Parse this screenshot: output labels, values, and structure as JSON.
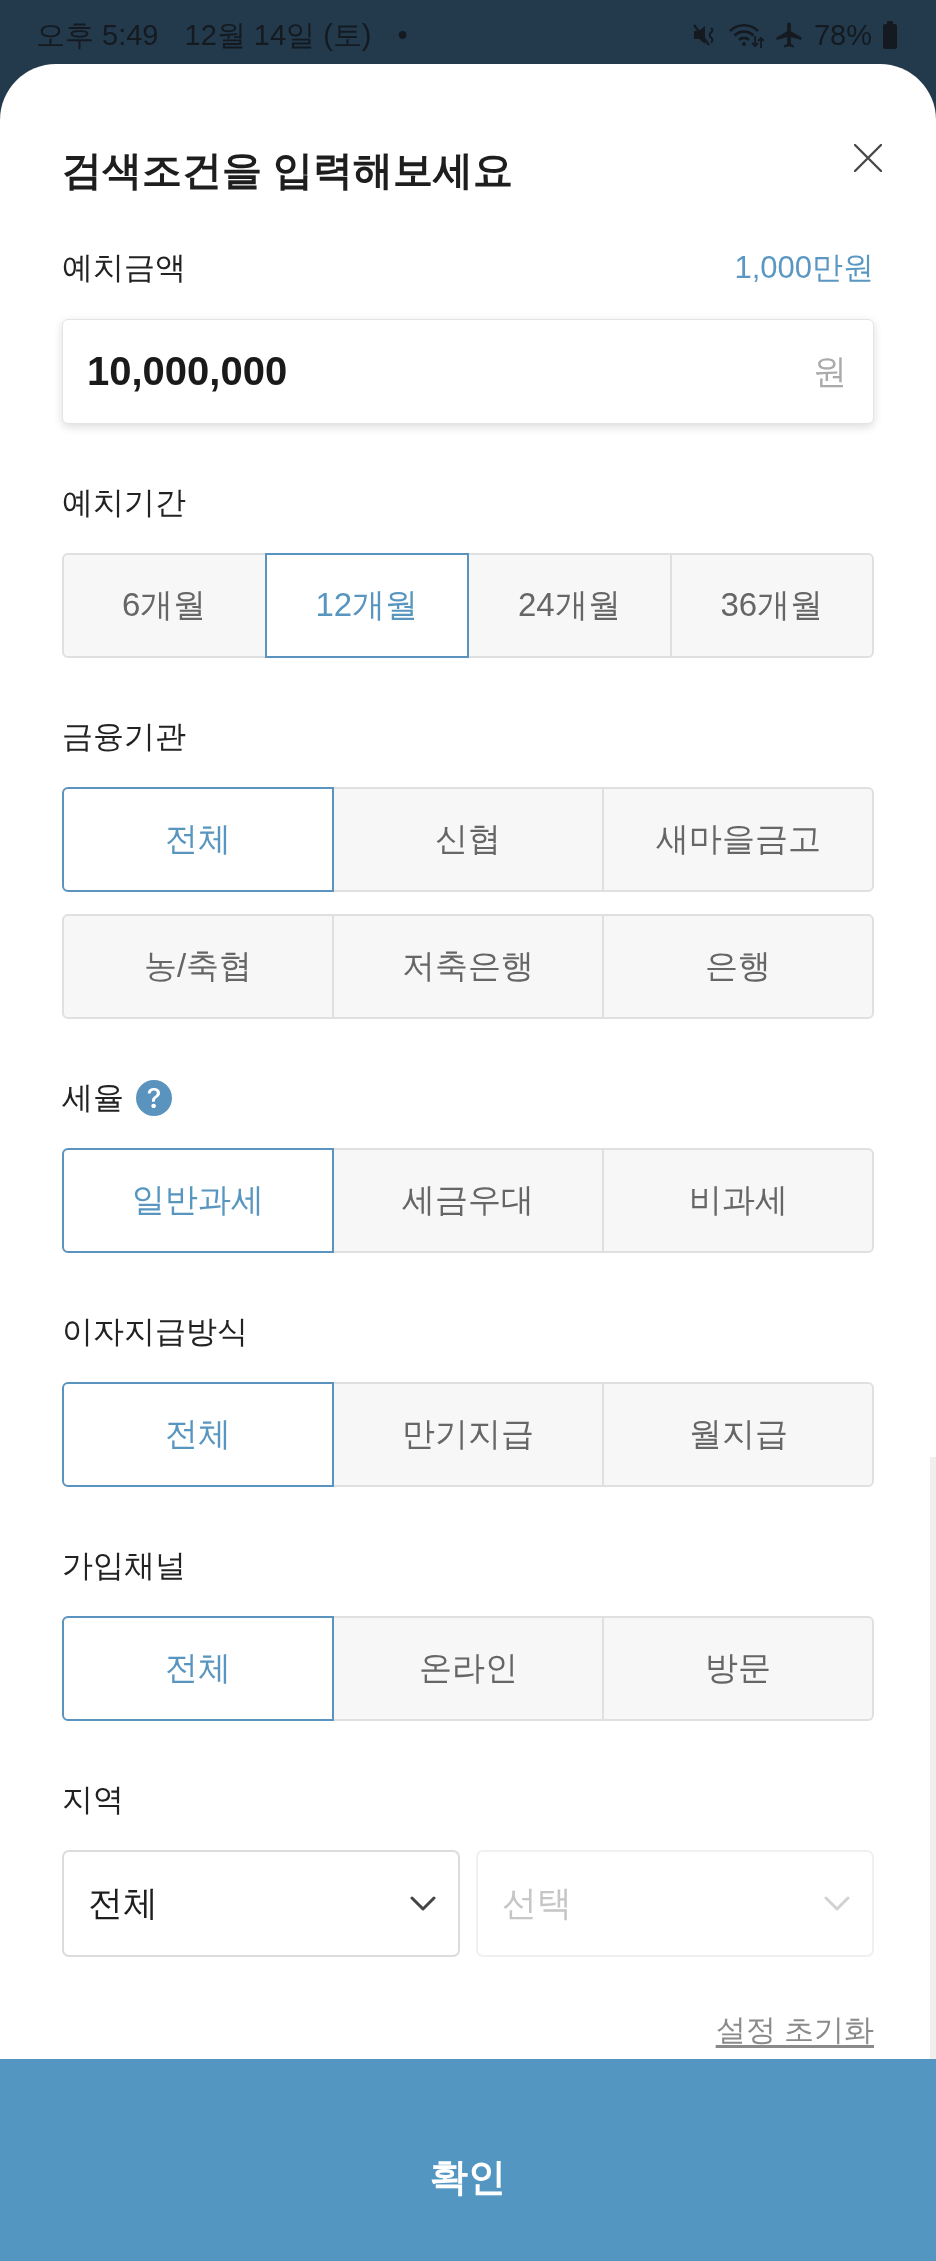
{
  "status_bar": {
    "time": "오후 5:49",
    "date": "12월 14일 (토)",
    "notification_dot": "•",
    "battery": "78%"
  },
  "sheet": {
    "title": "검색조건을 입력해보세요"
  },
  "deposit_amount": {
    "label": "예치금액",
    "summary": "1,000만원",
    "value": "10,000,000",
    "unit": "원"
  },
  "filters": [
    {
      "label": "예치기간",
      "rows": [
        [
          {
            "label": "6개월",
            "selected": false
          },
          {
            "label": "12개월",
            "selected": true
          },
          {
            "label": "24개월",
            "selected": false
          },
          {
            "label": "36개월",
            "selected": false
          }
        ]
      ]
    },
    {
      "label": "금융기관",
      "rows": [
        [
          {
            "label": "전체",
            "selected": true
          },
          {
            "label": "신협",
            "selected": false
          },
          {
            "label": "새마을금고",
            "selected": false
          }
        ],
        [
          {
            "label": "농/축협",
            "selected": false
          },
          {
            "label": "저축은행",
            "selected": false
          },
          {
            "label": "은행",
            "selected": false
          }
        ]
      ]
    },
    {
      "label": "세율",
      "help": true,
      "rows": [
        [
          {
            "label": "일반과세",
            "selected": true
          },
          {
            "label": "세금우대",
            "selected": false
          },
          {
            "label": "비과세",
            "selected": false
          }
        ]
      ]
    },
    {
      "label": "이자지급방식",
      "rows": [
        [
          {
            "label": "전체",
            "selected": true
          },
          {
            "label": "만기지급",
            "selected": false
          },
          {
            "label": "월지급",
            "selected": false
          }
        ]
      ]
    },
    {
      "label": "가입채널",
      "rows": [
        [
          {
            "label": "전체",
            "selected": true
          },
          {
            "label": "온라인",
            "selected": false
          },
          {
            "label": "방문",
            "selected": false
          }
        ]
      ]
    }
  ],
  "region": {
    "label": "지역",
    "selects": [
      {
        "value": "전체",
        "disabled": false
      },
      {
        "placeholder": "선택",
        "disabled": true
      }
    ]
  },
  "reset_link": "설정 초기화",
  "confirm_button": "확인"
}
